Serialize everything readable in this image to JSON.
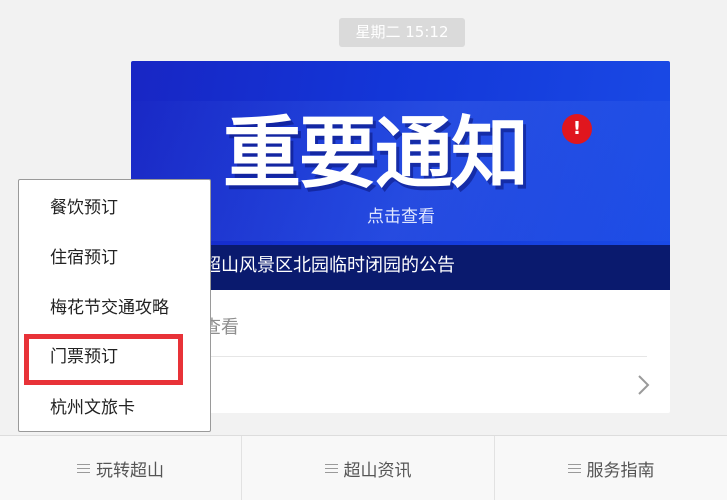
{
  "timestamp": "星期二  15:12",
  "card": {
    "banner_headline": "重要通知",
    "badge": "!",
    "banner_subtitle": "点击查看",
    "caption": "超山风景区北园临时闭园的公告",
    "view_link": "查看",
    "chevron_icon": "chevron-right-icon"
  },
  "menu": {
    "items": [
      {
        "label": "餐饮预订"
      },
      {
        "label": "住宿预订"
      },
      {
        "label": "梅花节交通攻略"
      },
      {
        "label": "门票预订",
        "highlighted": true
      },
      {
        "label": "杭州文旅卡"
      }
    ]
  },
  "footer": {
    "tabs": [
      {
        "label": "玩转超山",
        "icon": "menu-lines-icon"
      },
      {
        "label": "超山资讯",
        "icon": "menu-lines-icon"
      },
      {
        "label": "服务指南",
        "icon": "menu-lines-icon"
      }
    ]
  },
  "colors": {
    "banner_blue": "#1336d8",
    "highlight_red": "#e83238",
    "badge_red": "#e0161e"
  }
}
